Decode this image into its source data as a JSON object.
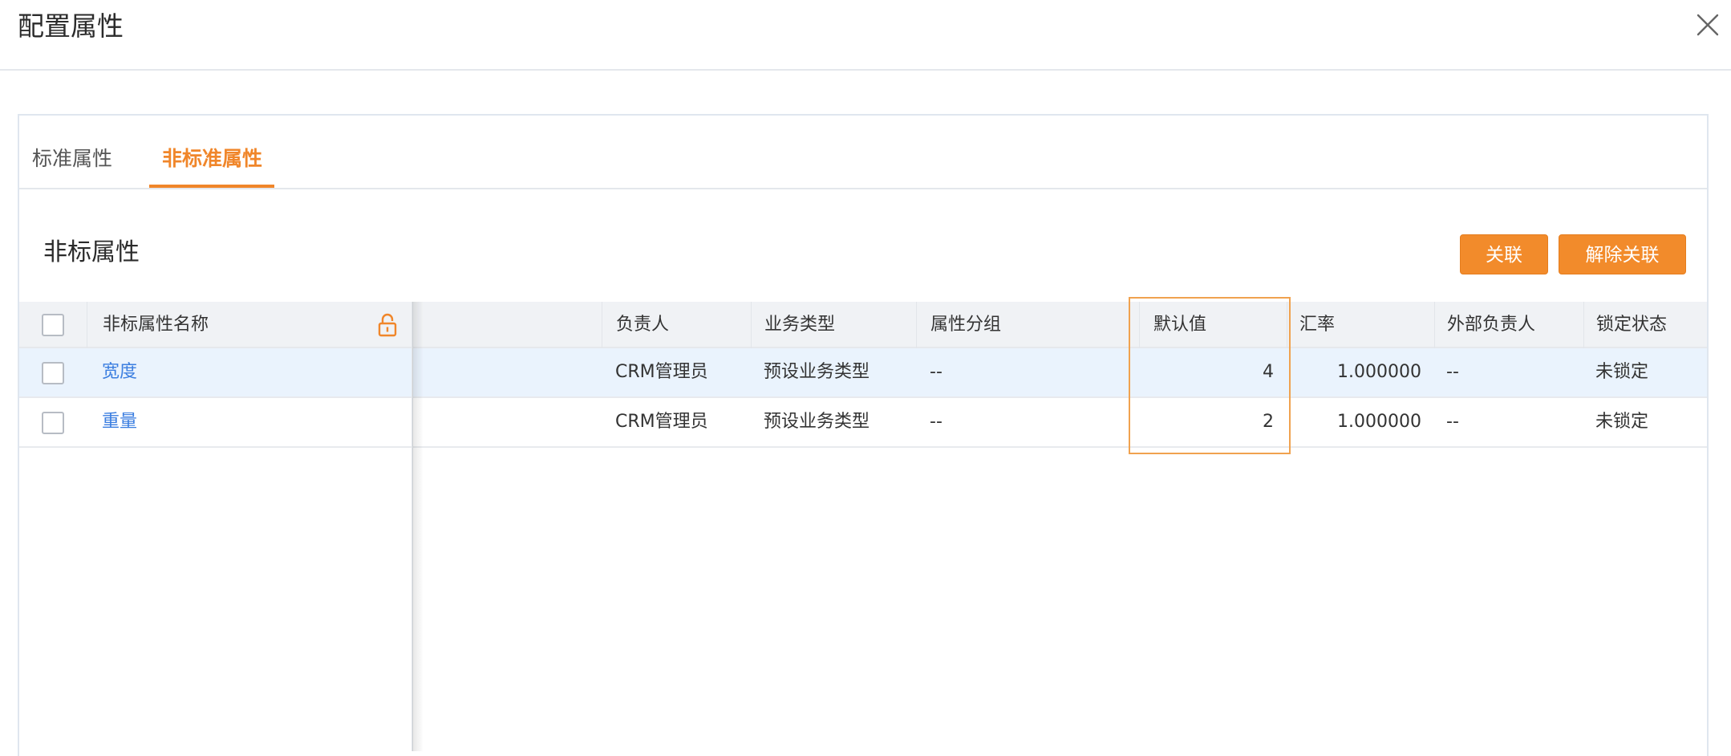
{
  "dialog": {
    "title": "配置属性"
  },
  "tabs": [
    {
      "label": "标准属性"
    },
    {
      "label": "非标准属性"
    }
  ],
  "section": {
    "title": "非标属性"
  },
  "buttons": {
    "link": "关联",
    "unlink": "解除关联"
  },
  "table": {
    "columns": {
      "name": "非标属性名称",
      "owner": "负责人",
      "biz_type": "业务类型",
      "group": "属性分组",
      "default": "默认值",
      "rate": "汇率",
      "ext_owner": "外部负责人",
      "lock": "锁定状态"
    },
    "rows": [
      {
        "name": "宽度",
        "owner": "CRM管理员",
        "biz_type": "预设业务类型",
        "group": "--",
        "default": "4",
        "rate": "1.000000",
        "ext_owner": "--",
        "lock": "未锁定"
      },
      {
        "name": "重量",
        "owner": "CRM管理员",
        "biz_type": "预设业务类型",
        "group": "--",
        "default": "2",
        "rate": "1.000000",
        "ext_owner": "--",
        "lock": "未锁定"
      }
    ]
  },
  "colors": {
    "accent": "#f0862a",
    "link": "#3b7ee0",
    "row_highlight": "#eaf3fd"
  },
  "icons": [
    "close-icon",
    "lock-icon"
  ]
}
